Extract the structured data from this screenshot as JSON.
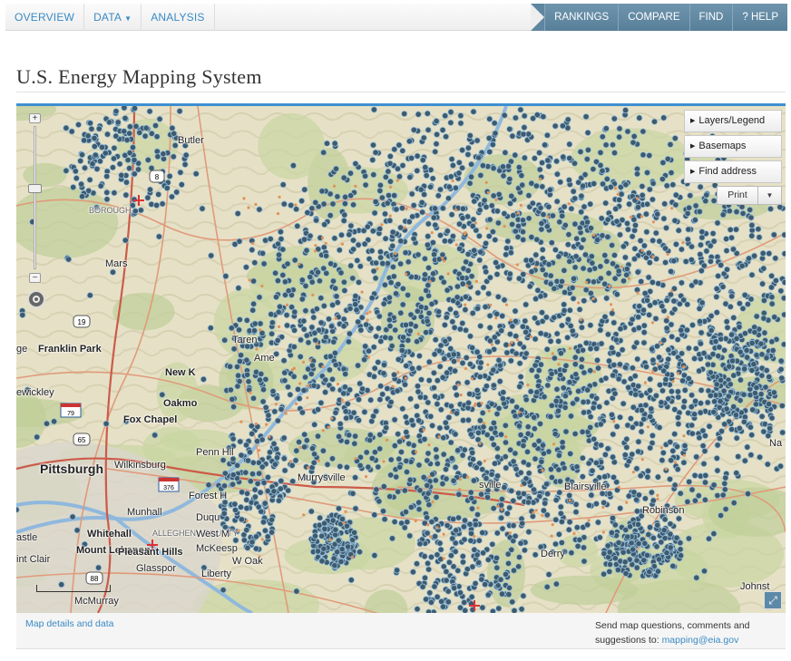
{
  "nav": {
    "left": [
      {
        "label": "OVERVIEW"
      },
      {
        "label": "DATA"
      },
      {
        "label": "ANALYSIS"
      }
    ],
    "right": [
      {
        "label": "RANKINGS"
      },
      {
        "label": "COMPARE"
      },
      {
        "label": "FIND"
      },
      {
        "label": "? HELP"
      }
    ]
  },
  "page": {
    "title": "U.S. Energy Mapping System"
  },
  "map": {
    "panel": {
      "layers_label": "Layers/Legend",
      "basemaps_label": "Basemaps",
      "find_label": "Find address",
      "print_label": "Print"
    },
    "places": {
      "butler": "Butler",
      "mars": "Mars",
      "franklin_park": "Franklin Park",
      "new_kensington": "New K",
      "sewickley": "ewickley",
      "oakmont": "Oakmo",
      "fox_chapel": "Fox Chapel",
      "pittsburgh": "Pittsburgh",
      "wilkinsburg": "Wilkinsburg",
      "penn_hills": "Penn Hil",
      "monroeville": "Murrysville",
      "forest_hills": "Forest H",
      "munhall": "Munhall",
      "duquesne": "Duqu",
      "whitehall": "Whitehall",
      "west_mifflin": "West M",
      "mount_lebanon": "Mount Lebanon",
      "pleasant_hills": "Pleasant Hills",
      "mckeesport": "McKeesp",
      "saint_clair": "int Clair",
      "castle": "astle",
      "glassport": "Glasspor",
      "liberty": "Liberty",
      "white_oak": "W Oak",
      "mcmurray": "McMurray",
      "blairsville": "Blairsville",
      "robinson": "Robinson",
      "derry": "Derry",
      "johnstown": "Johnst",
      "edge_na": "Na",
      "edge_ge": "ge",
      "edge_sville": "sville",
      "amer": "Ame",
      "tarentum": "Taren",
      "allegheny_county": "ALLEGHENY COUNTY",
      "boro": "BOROUGH"
    },
    "route_shields": [
      "8",
      "19",
      "65",
      "88",
      "376",
      "79"
    ]
  },
  "footer": {
    "details_link": "Map details and data",
    "contact_line1": "Send map questions, comments and",
    "contact_line2": "suggestions to:",
    "contact_email": "mapping@eia.gov"
  }
}
